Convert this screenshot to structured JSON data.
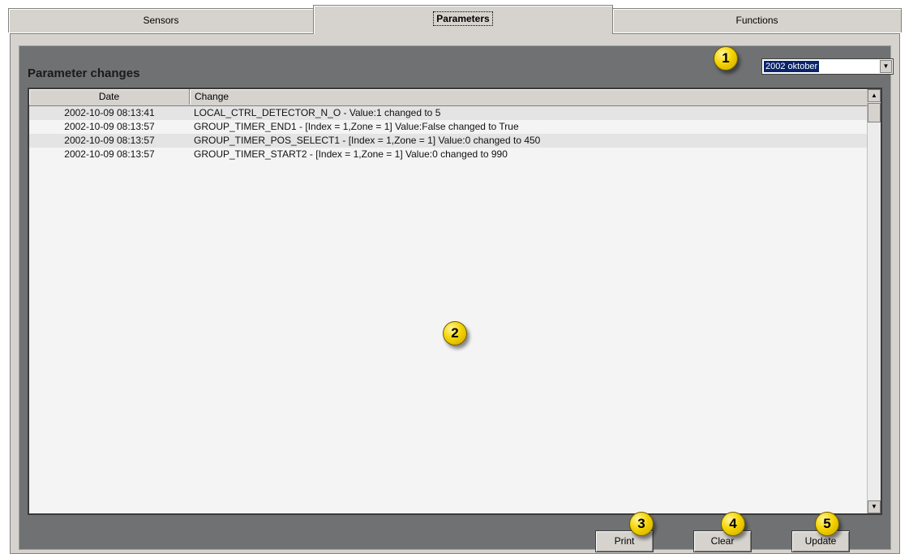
{
  "tabs": [
    {
      "label": "Sensors",
      "active": false
    },
    {
      "label": "Parameters",
      "active": true
    },
    {
      "label": "Functions",
      "active": false
    }
  ],
  "section": {
    "title": "Parameter changes"
  },
  "period_select": {
    "value": "2002 oktober"
  },
  "table": {
    "columns": [
      "Date",
      "Change"
    ],
    "rows": [
      {
        "date": "2002-10-09 08:13:41",
        "change": "LOCAL_CTRL_DETECTOR_N_O - Value:1 changed to 5"
      },
      {
        "date": "2002-10-09 08:13:57",
        "change": "GROUP_TIMER_END1 - [Index = 1,Zone = 1] Value:False changed to True"
      },
      {
        "date": "2002-10-09 08:13:57",
        "change": "GROUP_TIMER_POS_SELECT1 - [Index = 1,Zone = 1] Value:0 changed to 450"
      },
      {
        "date": "2002-10-09 08:13:57",
        "change": "GROUP_TIMER_START2 - [Index = 1,Zone = 1] Value:0 changed to 990"
      }
    ]
  },
  "buttons": {
    "print": "Print",
    "clear": "Clear",
    "update": "Update"
  },
  "markers": [
    "1",
    "2",
    "3",
    "4",
    "5"
  ],
  "icons": {
    "combo_arrow": "chevron-down-icon",
    "scroll_up": "arrow-up-icon",
    "scroll_down": "arrow-down-icon"
  },
  "colors": {
    "selection": "#0a246a",
    "marker": "#f5d400",
    "panel": "#6f7172"
  }
}
